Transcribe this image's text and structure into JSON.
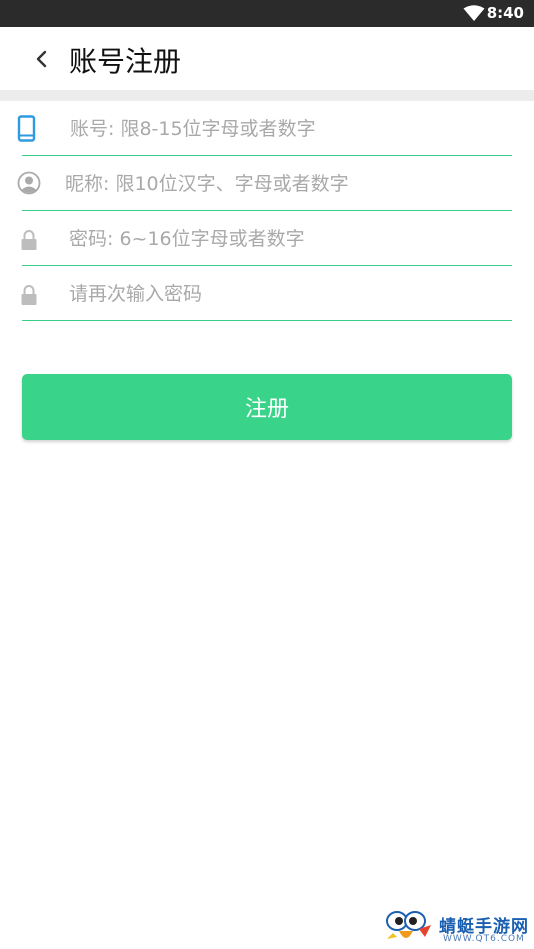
{
  "status_bar": {
    "time": "8:40",
    "wifi_icon": "wifi-icon"
  },
  "header": {
    "title": "账号注册",
    "back_icon": "chevron-left-icon"
  },
  "form": {
    "fields": [
      {
        "name": "account",
        "icon": "phone-icon",
        "placeholder": "账号: 限8-15位字母或者数字",
        "value": ""
      },
      {
        "name": "nickname",
        "icon": "user-icon",
        "placeholder": "昵称: 限10位汉字、字母或者数字",
        "value": ""
      },
      {
        "name": "password",
        "icon": "lock-icon",
        "placeholder": "密码: 6~16位字母或者数字",
        "value": ""
      },
      {
        "name": "confirm_password",
        "icon": "lock-icon",
        "placeholder": "请再次输入密码",
        "value": ""
      }
    ],
    "submit_label": "注册"
  },
  "watermark": {
    "brand": "蜻蜓手游网",
    "url": "WWW.QT6.COM"
  },
  "colors": {
    "accent": "#3ad38a",
    "underline": "#3ccf8a",
    "phone_icon": "#2f9ae0",
    "status_bar": "#2b2b2b"
  }
}
